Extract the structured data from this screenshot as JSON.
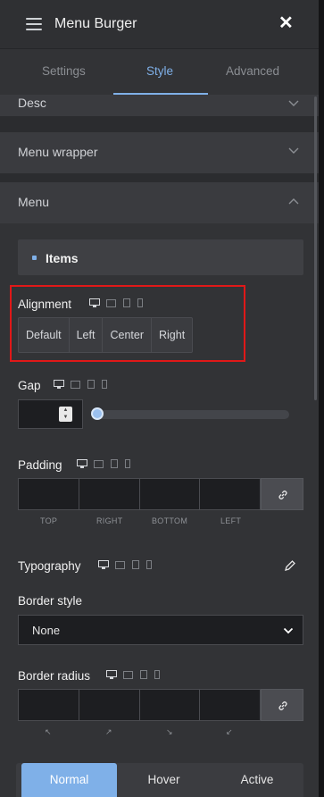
{
  "header": {
    "title": "Menu Burger",
    "close_label": "✕"
  },
  "tabs": [
    {
      "label": "Settings",
      "active": false
    },
    {
      "label": "Style",
      "active": true
    },
    {
      "label": "Advanced",
      "active": false
    }
  ],
  "sections": {
    "desc": "Desc",
    "menu_wrapper": "Menu wrapper",
    "menu": "Menu"
  },
  "items_group": "Items",
  "alignment": {
    "label": "Alignment",
    "options": [
      "Default",
      "Left",
      "Center",
      "Right"
    ]
  },
  "gap": {
    "label": "Gap",
    "value": "",
    "slider_level": 0
  },
  "padding": {
    "label": "Padding",
    "sides": [
      "TOP",
      "RIGHT",
      "BOTTOM",
      "LEFT"
    ]
  },
  "typography": {
    "label": "Typography"
  },
  "border_style": {
    "label": "Border style",
    "value": "None"
  },
  "border_radius": {
    "label": "Border radius",
    "corners": [
      "↖",
      "↗",
      "↘",
      "↙"
    ]
  },
  "states": [
    {
      "label": "Normal",
      "active": true
    },
    {
      "label": "Hover",
      "active": false
    },
    {
      "label": "Active",
      "active": false
    }
  ],
  "colors": {
    "accent": "#7fb0e8",
    "highlight_box": "#e01818"
  }
}
